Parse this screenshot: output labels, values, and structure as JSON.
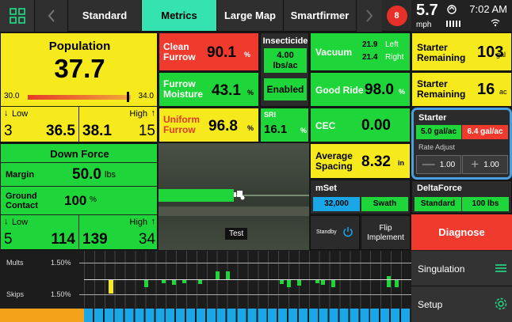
{
  "topbar": {
    "tabs": [
      "Standard",
      "Metrics",
      "Large Map",
      "Smartfirmer"
    ],
    "alert_count": "8",
    "speed": "5.7",
    "speed_unit": "mph",
    "time": "7:02 AM"
  },
  "population": {
    "title": "Population",
    "value": "37.7",
    "scale_min": "30.0",
    "scale_max": "34.0",
    "low_label": "Low",
    "high_label": "High",
    "low_count": "3",
    "low_value": "36.5",
    "high_value": "38.1",
    "high_count": "15"
  },
  "clean_furrow": {
    "label1": "Clean",
    "label2": "Furrow",
    "value": "90.1",
    "unit": "%"
  },
  "furrow_moisture": {
    "label1": "Furrow",
    "label2": "Moisture",
    "value": "43.1",
    "unit": "%"
  },
  "uniform_furrow": {
    "label1": "Uniform",
    "label2": "Furrow",
    "value": "96.8",
    "unit": "%"
  },
  "insecticide": {
    "title": "Insecticide",
    "rate": "4.00",
    "rate_unit": "lbs/ac",
    "status": "Enabled"
  },
  "sri": {
    "label": "SRI",
    "value": "16.1",
    "unit": "%"
  },
  "vacuum": {
    "label": "Vacuum",
    "left_value": "21.9",
    "left_label": "Left",
    "right_value": "21.4",
    "right_label": "Right"
  },
  "good_ride": {
    "label": "Good Ride",
    "value": "98.0",
    "unit": "%"
  },
  "cec": {
    "label": "CEC",
    "value": "0.00"
  },
  "avg_spacing": {
    "label1": "Average",
    "label2": "Spacing",
    "value": "8.32",
    "unit": "in"
  },
  "starter_remaining_gal": {
    "label1": "Starter",
    "label2": "Remaining",
    "value": "103",
    "unit": "gal"
  },
  "starter_remaining_ac": {
    "label1": "Starter",
    "label2": "Remaining",
    "value": "16",
    "unit": "ac"
  },
  "starter": {
    "title": "Starter",
    "target": "5.0 gal/ac",
    "actual": "6.4 gal/ac",
    "rate_adjust_label": "Rate Adjust",
    "minus_value": "1.00",
    "plus_value": "1.00"
  },
  "down_force": {
    "title": "Down Force",
    "margin_label": "Margin",
    "margin_value": "50.0",
    "margin_unit": "lbs",
    "ground_label1": "Ground",
    "ground_label2": "Contact",
    "ground_value": "100",
    "ground_unit": "%",
    "low_label": "Low",
    "high_label": "High",
    "low_count": "5",
    "low_value": "114",
    "high_value": "139",
    "high_count": "34"
  },
  "map": {
    "label": "Test"
  },
  "mset": {
    "title": "mSet",
    "value": "32,000",
    "mode": "Swath"
  },
  "standby": {
    "label": "Standby"
  },
  "flip": {
    "label1": "Flip",
    "label2": "Implement"
  },
  "deltaforce": {
    "title": "DeltaForce",
    "mode": "Standard",
    "value": "100 lbs"
  },
  "diagnose": {
    "label": "Diagnose"
  },
  "singulation": {
    "label": "Singulation"
  },
  "setup": {
    "label": "Setup"
  },
  "row_chart": {
    "mults_label": "Mults",
    "mults_pct": "1.50%",
    "skips_label": "Skips",
    "skips_pct": "1.50%"
  },
  "colors": {
    "yellow": "#f7ea1c",
    "green": "#1fd63a",
    "red": "#f03a2e",
    "blue": "#1aa7e8",
    "highlight": "#4a9fe0"
  }
}
